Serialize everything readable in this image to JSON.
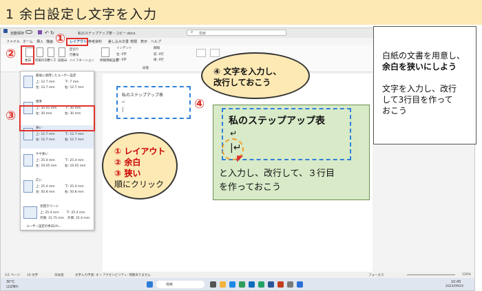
{
  "header": {
    "title": "1 余白設定し文字を入力"
  },
  "word": {
    "autosave": "自動保存",
    "doc_title": "私のステップアップ表・コピー.docx",
    "search_placeholder": "検索",
    "menu": [
      "ファイル",
      "ホーム",
      "挿入",
      "描画",
      "レイアウト",
      "参考資料",
      "差し込み文書",
      "校閲",
      "表示",
      "ヘルプ"
    ],
    "ribbon": {
      "margins": "余白",
      "orientation": "印刷の向き",
      "size": "サイズ",
      "columns": "段組み",
      "breaks": "区切り",
      "line_numbers": "行番号",
      "hyphenation": "ハイフネーション",
      "manuscript": "原稿用紙設定",
      "indent": "インデント",
      "spacing": "間隔",
      "paragraph": "段落",
      "indent_left": "左: 0字",
      "indent_right": "右: 0字",
      "spacing_before": "前: 0行",
      "spacing_after": "後: 0行"
    },
    "margins_panel": {
      "items": [
        {
          "name": "最後に適用したユーザー設定",
          "top": "上: 12.7 mm",
          "bottom": "下: 7 mm",
          "left": "左: 12.7 mm",
          "right": "右: 12.7 mm"
        },
        {
          "name": "標準",
          "top": "上: 35.01 mm",
          "bottom": "下: 30 mm",
          "left": "左: 30 mm",
          "right": "右: 30 mm"
        },
        {
          "name": "狭い",
          "top": "上: 12.7 mm",
          "bottom": "下: 12.7 mm",
          "left": "左: 12.7 mm",
          "right": "右: 12.7 mm"
        },
        {
          "name": "やや狭い",
          "top": "上: 25.4 mm",
          "bottom": "下: 25.4 mm",
          "left": "左: 19.05 mm",
          "right": "右: 19.05 mm"
        },
        {
          "name": "広い",
          "top": "上: 25.4 mm",
          "bottom": "下: 25.4 mm",
          "left": "左: 50.8 mm",
          "right": "右: 50.8 mm"
        },
        {
          "name": "見開きページ",
          "top": "上: 25.4 mm",
          "bottom": "下: 25.4 mm",
          "left": "内側: 31.75 mm",
          "right": "外側: 25.4 mm"
        }
      ],
      "custom": "ユーザー設定の余白(A)..."
    },
    "doc_text": "私のステップアップ表",
    "status": {
      "page": "1/1 ページ",
      "words": "10 文字",
      "lang": "日本語",
      "prediction": "文字入力予測: オン",
      "accessibility": "アクセシビリティ: 問題ありません",
      "focus": "フォーカス",
      "zoom": "120%"
    },
    "taskbar": {
      "weather": "30°C",
      "weather_sub": "ほぼ晴れ",
      "search": "検索",
      "time": "10:45",
      "date": "2023/09/24"
    }
  },
  "callouts": {
    "step1": "①",
    "step2": "②",
    "step3": "③",
    "step4": "④",
    "bubble_lines": [
      "① レイアウト",
      "② 余白",
      "③ 狭い",
      "順にクリック"
    ],
    "bubble_top_line1": "④ 文字を入力し、",
    "bubble_top_line2": "改行しておこう",
    "zoom_title": "私のステップアップ表",
    "zoom_caption1": "と入力し、改行して、３行目",
    "zoom_caption2": "を作っておこう",
    "note_lines": [
      "白紙の文書を用意し、",
      "余白を狭いにしよう",
      "",
      "文字を入力し、改行",
      "して3行目を作って",
      "おこう"
    ]
  },
  "colors": {
    "accent_red": "#e0302a",
    "dash_blue": "#2f80d8",
    "bubble_fill": "#fde9b4",
    "green_panel": "#d8eac8"
  }
}
